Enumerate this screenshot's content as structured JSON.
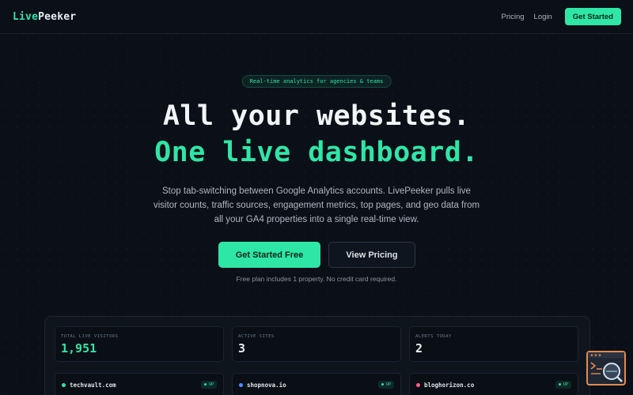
{
  "nav": {
    "logo_part1": "Live",
    "logo_part2": "Peeker",
    "links": [
      "Pricing",
      "Login"
    ],
    "cta_label": "Get Started"
  },
  "hero": {
    "badge": "Real-time analytics for agencies & teams",
    "headline_line1": "All your websites.",
    "headline_line2": "One live dashboard.",
    "subtext": "Stop tab-switching between Google Analytics accounts. LivePeeker pulls live visitor counts, traffic sources, engagement metrics, top pages, and geo data from all your GA4 properties into a single real-time view.",
    "primary_cta": "Get Started Free",
    "secondary_cta": "View Pricing",
    "note": "Free plan includes 1 property. No credit card required."
  },
  "dashboard": {
    "stats": [
      {
        "label": "TOTAL LIVE VISITORS",
        "value": "1,951",
        "color": "#2ee6a6"
      },
      {
        "label": "ACTIVE SITES",
        "value": "3",
        "color": "#e6edf3"
      },
      {
        "label": "ALERTS TODAY",
        "value": "2",
        "color": "#e6edf3"
      }
    ],
    "sites": [
      {
        "name": "techvault.com",
        "status": "● UP",
        "dot_color": "#2ee6a6"
      },
      {
        "name": "shopnova.io",
        "status": "● UP",
        "dot_color": "#4c8dff"
      },
      {
        "name": "bloghorizon.co",
        "status": "● UP",
        "dot_color": "#ff5c8a"
      }
    ]
  },
  "colors": {
    "accent": "#2ee6a6",
    "background": "#0b0f17",
    "widget_border": "#e08a52"
  }
}
